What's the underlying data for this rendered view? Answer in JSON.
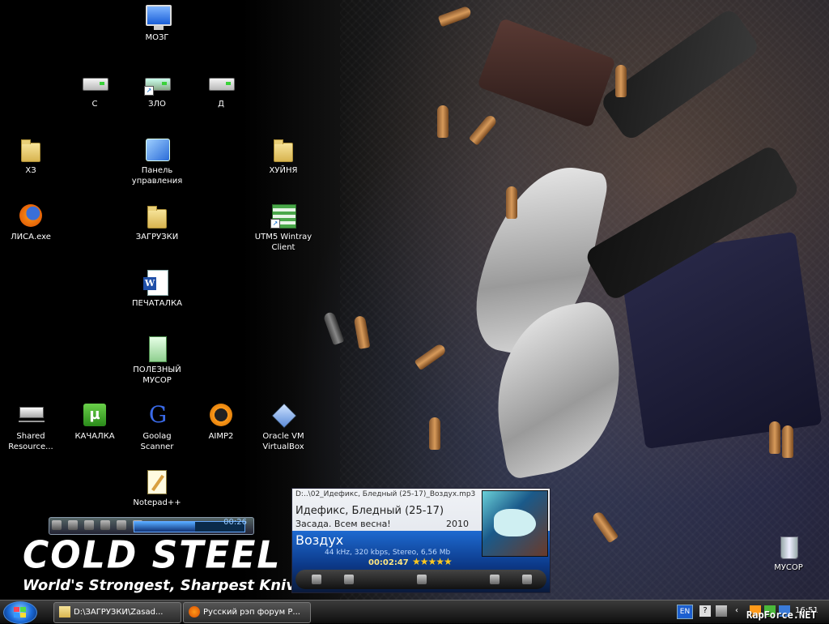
{
  "desktop_icons": [
    {
      "label": "МОЗГ"
    },
    {
      "label": "С"
    },
    {
      "label": "ЗЛО"
    },
    {
      "label": "Д"
    },
    {
      "label": "ХЗ"
    },
    {
      "label": "Панель\nуправления"
    },
    {
      "label": "ХУЙНЯ"
    },
    {
      "label": "ЛИСА.exe"
    },
    {
      "label": "ЗАГРУЗКИ"
    },
    {
      "label": "UTM5 Wintray\nClient"
    },
    {
      "label": "ПЕЧАТАЛКА"
    },
    {
      "label": "ПОЛЕЗНЫЙ\nМУСОР"
    },
    {
      "label": "Shared\nResource..."
    },
    {
      "label": "КАЧАЛКА"
    },
    {
      "label": "Goolag\nScanner"
    },
    {
      "label": "AIMP2"
    },
    {
      "label": "Oracle VM\nVirtualBox"
    },
    {
      "label": "Notepad++"
    },
    {
      "label": "МУСОР"
    }
  ],
  "wallpaper": {
    "brand": "COLD STEEL",
    "tagline": "World's Strongest, Sharpest Knives"
  },
  "mini_player": {
    "time": "00:26",
    "progress": 0.55
  },
  "aimp": {
    "path": "D:..\\02_Идефикс, Бледный (25-17)_Воздух.mp3",
    "artist": "Идефикс, Бледный (25-17)",
    "album": "Засада. Всем весна!",
    "year": "2010",
    "track": "Воздух",
    "info": "44 kHz, 320 kbps, Stereo, 6,56 Mb",
    "elapsed": "00:02:47",
    "rating": "★★★★★"
  },
  "taskbar": {
    "buttons": [
      {
        "label": "D:\\ЗАГРУЗКИ\\Zasad..."
      },
      {
        "label": "Русский рэп форум Р..."
      }
    ],
    "lang": "EN",
    "clock": "16:51"
  },
  "watermark": "RapForce.NET",
  "colors": {
    "taskbar": "#1a1a1a",
    "aimp_accent": "#1e6ad0",
    "folder": "#e9cf78"
  }
}
